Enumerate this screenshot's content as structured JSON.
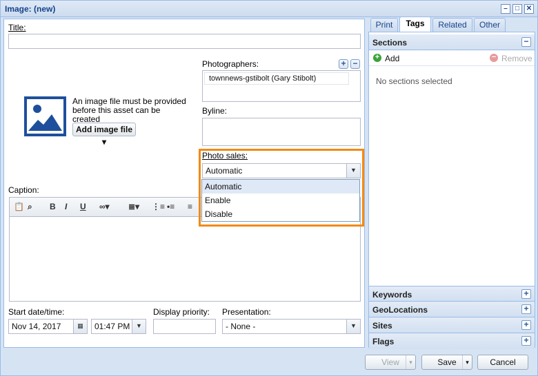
{
  "window": {
    "title": "Image: (new)"
  },
  "form": {
    "title_label": "Title:",
    "title_value": "",
    "image_notice": "An image file must be provided before this asset can be created",
    "add_image_label": "Add image file",
    "photographers_label": "Photographers:",
    "photographers": [
      "townnews-gstibolt (Gary Stibolt)"
    ],
    "byline_label": "Byline:",
    "byline_value": "",
    "photo_sales_label": "Photo sales:",
    "photo_sales_value": "Automatic",
    "photo_sales_options": [
      "Automatic",
      "Enable",
      "Disable"
    ],
    "caption_label": "Caption:",
    "start_label": "Start date/time:",
    "start_date": "Nov 14, 2017",
    "start_time": "01:47 PM",
    "priority_label": "Display priority:",
    "priority_value": "",
    "presentation_label": "Presentation:",
    "presentation_value": "- None -"
  },
  "tabs": [
    "Print",
    "Tags",
    "Related",
    "Other"
  ],
  "active_tab": "Tags",
  "sections": {
    "title": "Sections",
    "add_label": "Add",
    "remove_label": "Remove",
    "empty_text": "No sections selected"
  },
  "collapsed_panels": [
    "Keywords",
    "GeoLocations",
    "Sites",
    "Flags"
  ],
  "footer": {
    "view_label": "View",
    "save_label": "Save",
    "cancel_label": "Cancel"
  },
  "colors": {
    "accent": "#15428b",
    "highlight": "#f28a16",
    "border": "#99bbe8"
  }
}
